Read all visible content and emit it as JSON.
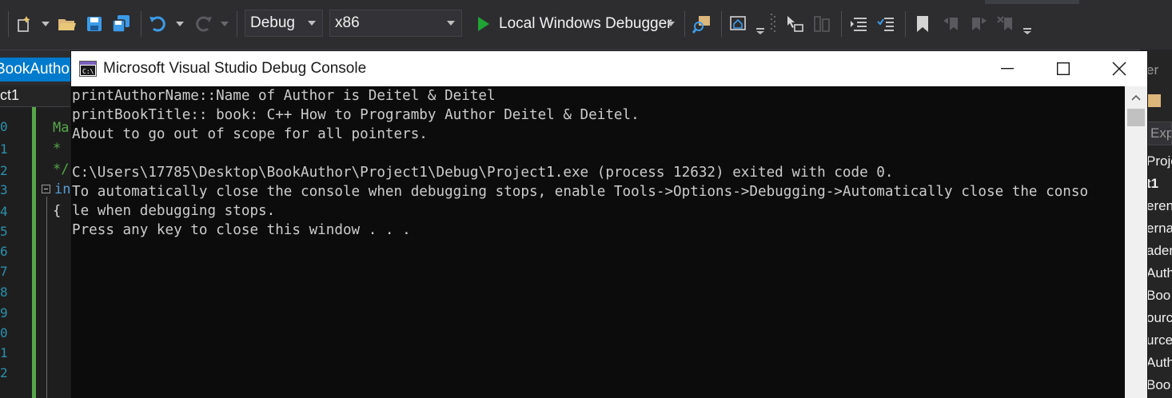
{
  "toolbar": {
    "config": "Debug",
    "platform": "x86",
    "run_label": "Local Windows Debugger",
    "accent_play": "#1fa335"
  },
  "editor": {
    "tab_label": "BookAuthor.",
    "nav_label": "ct1",
    "line_numbers": [
      "0",
      "1",
      "2",
      "3",
      "4",
      "5",
      "6",
      "7",
      "8",
      "9",
      "0",
      "1",
      "2"
    ],
    "frag_ma": "Ma",
    "frag_star": "*",
    "frag_end_comment": "*/",
    "frag_in": "in",
    "frag_brace": "{"
  },
  "side_panel": {
    "header": "er",
    "search": "Exp",
    "items": [
      "Proje",
      "t1",
      "eren",
      "erna",
      "ader",
      "Auth",
      "Boo",
      "ourc",
      "urce",
      "Auth",
      "Boo"
    ]
  },
  "console": {
    "title": "Microsoft Visual Studio Debug Console",
    "icon": "console-app-icon",
    "lines": [
      "printAuthorName::Name of Author is Deitel & Deitel",
      "printBookTitle:: book: C++ How to Programby Author Deitel & Deitel.",
      "About to go out of scope for all pointers.",
      "",
      "C:\\Users\\17785\\Desktop\\BookAuthor\\Project1\\Debug\\Project1.exe (process 12632) exited with code 0.",
      "To automatically close the console when debugging stops, enable Tools->Options->Debugging->Automatically close the conso",
      "le when debugging stops.",
      "Press any key to close this window . . ."
    ]
  }
}
